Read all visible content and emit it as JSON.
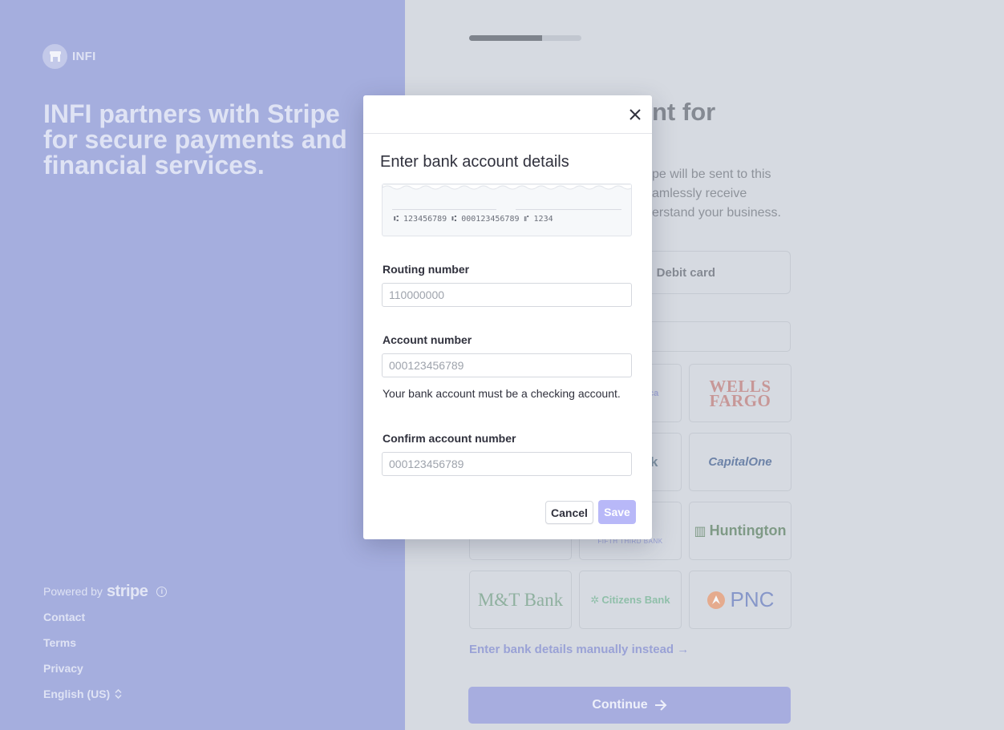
{
  "brand": {
    "name": "INFI"
  },
  "left": {
    "headline": "INFI partners with Stripe for secure payments and financial services.",
    "powered_by": "Powered by",
    "stripe_word": "stripe",
    "links": [
      "Contact",
      "Terms",
      "Privacy"
    ],
    "language": "English (US)"
  },
  "right": {
    "progress": 0.65,
    "title_fragment": "nt for",
    "desc_lines": [
      "pe will be sent to this",
      "amlessly receive",
      "erstand your business."
    ],
    "debit_tab": "Debit card",
    "banks": [
      {
        "name": "ca"
      },
      {
        "name": "WELLS FARGO"
      },
      {
        "name": "k"
      },
      {
        "name": "CapitalOne"
      },
      {
        "name": "FIFTH THIRD BANK"
      },
      {
        "name": "Huntington"
      },
      {
        "name": "M&T Bank"
      },
      {
        "name": "Citizens Bank"
      },
      {
        "name": "PNC"
      }
    ],
    "manual_link": "Enter bank details manually instead →",
    "continue": "Continue"
  },
  "modal": {
    "title": "Enter bank account details",
    "check_micr": "⑆ 123456789 ⑆ 000123456789 ⑈ 1234",
    "routing_label": "Routing number",
    "routing_placeholder": "110000000",
    "account_label": "Account number",
    "account_placeholder": "000123456789",
    "account_hint": "Your bank account must be a checking account.",
    "confirm_label": "Confirm account number",
    "confirm_placeholder": "000123456789",
    "cancel": "Cancel",
    "save": "Save"
  },
  "colors": {
    "left_bg": "#a5aede",
    "right_bg": "#d6dae1",
    "save_disabled": "#b8b8f8",
    "link": "#9aa2d6"
  }
}
